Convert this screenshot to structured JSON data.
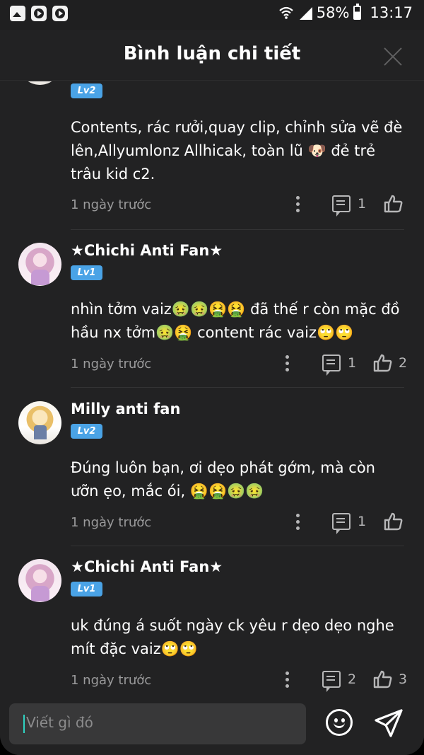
{
  "status_bar": {
    "battery": "58%",
    "time": "13:17",
    "icons": [
      "gallery-icon",
      "video-icon",
      "video-icon",
      "wifi-icon",
      "signal-icon",
      "battery-icon"
    ]
  },
  "header": {
    "title": "Bình luận chi tiết",
    "close_icon": "close-icon"
  },
  "comments": [
    {
      "username": "",
      "level": "Lv2",
      "text": "Contents, rác rưởi,quay clip, chỉnh sửa vẽ đè lên,Allyumlonz Allhicak, toàn lũ 🐶 đẻ trẻ trâu kid c2.",
      "time": "1 ngày trước",
      "replies": "1",
      "likes": ""
    },
    {
      "username": "★Chichi Anti Fan★",
      "level": "Lv1",
      "text": "nhìn tởm vaiz🤢🤢🤮🤮 đã thế r còn mặc đồ hầu nx tởm🤢🤮 content rác vaiz🙄🙄",
      "time": "1 ngày trước",
      "replies": "1",
      "likes": "2"
    },
    {
      "username": "Milly anti fan",
      "level": "Lv2",
      "text": "Đúng luôn bạn, ơi dẹo phát gớm, mà còn ưỡn ẹo, mắc ói, 🤮🤮🤢🤢",
      "time": "1 ngày trước",
      "replies": "1",
      "likes": ""
    },
    {
      "username": "★Chichi Anti Fan★",
      "level": "Lv1",
      "text": "uk đúng á suốt ngày ck yêu r dẹo dẹo nghe mít đặc vaiz🙄🙄",
      "time": "1 ngày trước",
      "replies": "2",
      "likes": "3"
    }
  ],
  "composer": {
    "placeholder": "Viết gì đó",
    "emoji_icon": "smiley-icon",
    "send_icon": "send-icon"
  },
  "colors": {
    "background": "#222223",
    "level_badge": "#4aa3e6",
    "muted_text": "#9a9a9b",
    "input_bg": "#383839",
    "caret": "#2fd3c2"
  }
}
